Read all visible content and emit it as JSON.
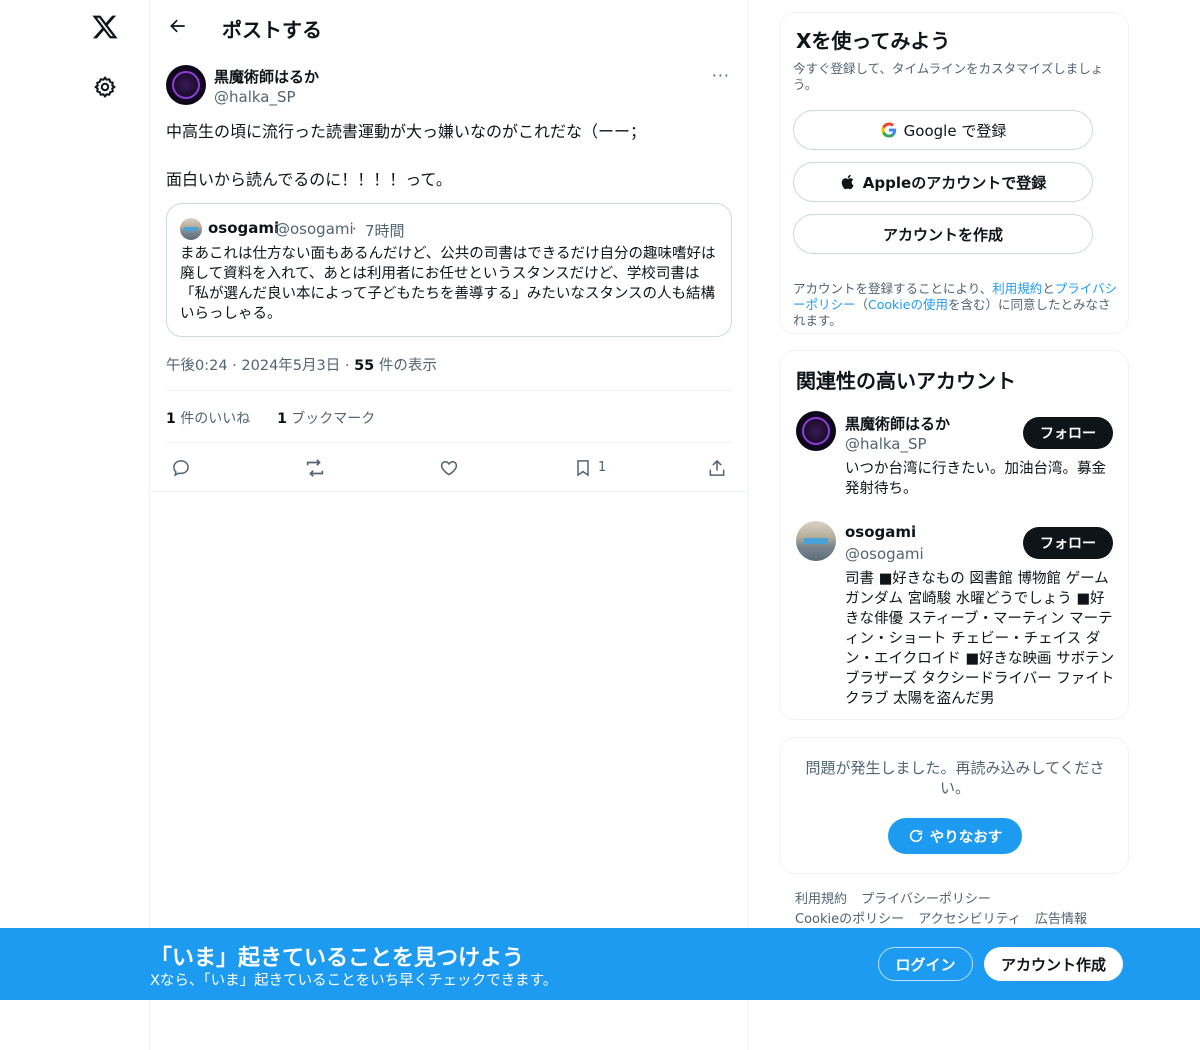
{
  "header": {
    "title": "ポストする"
  },
  "post": {
    "author_name": "黒魔術師はるか",
    "author_handle": "@halka_SP",
    "more": "···",
    "text": "中高生の頃に流行った読書運動が大っ嫌いなのがこれだな（ーー；\n\n面白いから読んでるのに！！！！って。",
    "quote": {
      "name": "osogami",
      "handle": "@osogami",
      "dot": "·",
      "time": "7時間",
      "text": "まあこれは仕方ない面もあるんだけど、公共の司書はできるだけ自分の趣味嗜好は廃して資料を入れて、あとは利用者にお任せというスタンスだけど、学校司書は「私が選んだ良い本によって子どもたちを善導する」みたいなスタンスの人も結構いらっしゃる。"
    },
    "timestamp": "午後0:24 · 2024年5月3日 · ",
    "views_count": "55",
    "views_label": " 件の表示",
    "likes_count": "1",
    "likes_label": " 件のいいね",
    "bookmarks_count": "1",
    "bookmarks_label": " ブックマーク",
    "bookmark_action_count": "1"
  },
  "signup_card": {
    "title": "Xを使ってみよう",
    "subtitle": "今すぐ登録して、タイムラインをカスタマイズしましょう。",
    "google": "Google で登録",
    "apple": "Appleのアカウントで登録",
    "create": "アカウントを作成",
    "legal_1": "アカウントを登録することにより、",
    "legal_terms": "利用規約",
    "legal_2": "と",
    "legal_privacy": "プライバシーポリシー",
    "legal_3": "（",
    "legal_cookie": "Cookieの使用",
    "legal_4": "を含む）に同意したとみなされます。"
  },
  "related": {
    "title": "関連性の高いアカウント",
    "accounts": [
      {
        "name": "黒魔術師はるか",
        "handle": "@halka_SP",
        "bio": "いつか台湾に行きたい。加油台湾。募金発射待ち。",
        "follow": "フォロー"
      },
      {
        "name": "osogami",
        "handle": "@osogami",
        "bio": "司書 ■好きなもの 図書館 博物館 ゲーム ガンダム 宮崎駿 水曜どうでしょう ■好きな俳優 スティーブ・マーティン マーティン・ショート チェビー・チェイス ダン・エイクロイド ■好きな映画 サボテンブラザーズ タクシードライバー ファイトクラブ 太陽を盗んだ男",
        "follow": "フォロー"
      }
    ]
  },
  "error_card": {
    "text": "問題が発生しました。再読み込みしてください。",
    "retry": "やりなおす"
  },
  "footer": {
    "links": [
      "利用規約",
      "プライバシーポリシー",
      "Cookieのポリシー",
      "アクセシビリティ",
      "広告情報"
    ]
  },
  "bottom_bar": {
    "title": "「いま」起きていることを見つけよう",
    "subtitle": "Xなら、「いま」起きていることをいち早くチェックできます。",
    "login": "ログイン",
    "signup": "アカウント作成"
  },
  "colors": {
    "accent": "#1d9bf0",
    "text": "#0f1419",
    "muted": "#536471",
    "border": "#eff3f4"
  }
}
